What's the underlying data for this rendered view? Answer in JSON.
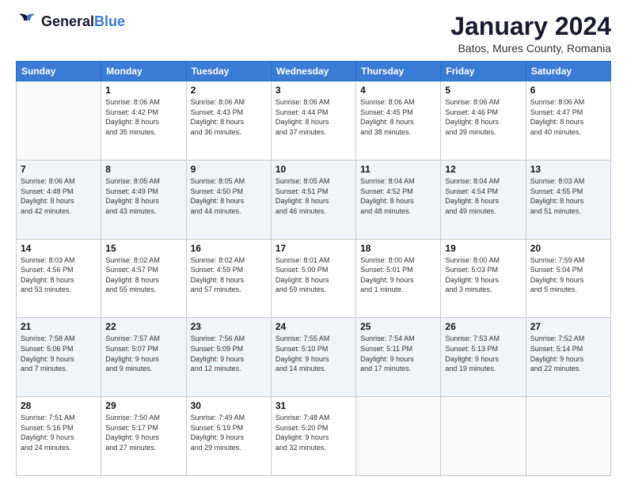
{
  "header": {
    "logo_general": "General",
    "logo_blue": "Blue",
    "month_title": "January 2024",
    "subtitle": "Batos, Mures County, Romania"
  },
  "weekdays": [
    "Sunday",
    "Monday",
    "Tuesday",
    "Wednesday",
    "Thursday",
    "Friday",
    "Saturday"
  ],
  "weeks": [
    [
      {
        "day": "",
        "info": ""
      },
      {
        "day": "1",
        "info": "Sunrise: 8:06 AM\nSunset: 4:42 PM\nDaylight: 8 hours\nand 35 minutes."
      },
      {
        "day": "2",
        "info": "Sunrise: 8:06 AM\nSunset: 4:43 PM\nDaylight: 8 hours\nand 36 minutes."
      },
      {
        "day": "3",
        "info": "Sunrise: 8:06 AM\nSunset: 4:44 PM\nDaylight: 8 hours\nand 37 minutes."
      },
      {
        "day": "4",
        "info": "Sunrise: 8:06 AM\nSunset: 4:45 PM\nDaylight: 8 hours\nand 38 minutes."
      },
      {
        "day": "5",
        "info": "Sunrise: 8:06 AM\nSunset: 4:46 PM\nDaylight: 8 hours\nand 39 minutes."
      },
      {
        "day": "6",
        "info": "Sunrise: 8:06 AM\nSunset: 4:47 PM\nDaylight: 8 hours\nand 40 minutes."
      }
    ],
    [
      {
        "day": "7",
        "info": "Sunrise: 8:06 AM\nSunset: 4:48 PM\nDaylight: 8 hours\nand 42 minutes."
      },
      {
        "day": "8",
        "info": "Sunrise: 8:05 AM\nSunset: 4:49 PM\nDaylight: 8 hours\nand 43 minutes."
      },
      {
        "day": "9",
        "info": "Sunrise: 8:05 AM\nSunset: 4:50 PM\nDaylight: 8 hours\nand 44 minutes."
      },
      {
        "day": "10",
        "info": "Sunrise: 8:05 AM\nSunset: 4:51 PM\nDaylight: 8 hours\nand 46 minutes."
      },
      {
        "day": "11",
        "info": "Sunrise: 8:04 AM\nSunset: 4:52 PM\nDaylight: 8 hours\nand 48 minutes."
      },
      {
        "day": "12",
        "info": "Sunrise: 8:04 AM\nSunset: 4:54 PM\nDaylight: 8 hours\nand 49 minutes."
      },
      {
        "day": "13",
        "info": "Sunrise: 8:03 AM\nSunset: 4:55 PM\nDaylight: 8 hours\nand 51 minutes."
      }
    ],
    [
      {
        "day": "14",
        "info": "Sunrise: 8:03 AM\nSunset: 4:56 PM\nDaylight: 8 hours\nand 53 minutes."
      },
      {
        "day": "15",
        "info": "Sunrise: 8:02 AM\nSunset: 4:57 PM\nDaylight: 8 hours\nand 55 minutes."
      },
      {
        "day": "16",
        "info": "Sunrise: 8:02 AM\nSunset: 4:59 PM\nDaylight: 8 hours\nand 57 minutes."
      },
      {
        "day": "17",
        "info": "Sunrise: 8:01 AM\nSunset: 5:00 PM\nDaylight: 8 hours\nand 59 minutes."
      },
      {
        "day": "18",
        "info": "Sunrise: 8:00 AM\nSunset: 5:01 PM\nDaylight: 9 hours\nand 1 minute."
      },
      {
        "day": "19",
        "info": "Sunrise: 8:00 AM\nSunset: 5:03 PM\nDaylight: 9 hours\nand 3 minutes."
      },
      {
        "day": "20",
        "info": "Sunrise: 7:59 AM\nSunset: 5:04 PM\nDaylight: 9 hours\nand 5 minutes."
      }
    ],
    [
      {
        "day": "21",
        "info": "Sunrise: 7:58 AM\nSunset: 5:06 PM\nDaylight: 9 hours\nand 7 minutes."
      },
      {
        "day": "22",
        "info": "Sunrise: 7:57 AM\nSunset: 5:07 PM\nDaylight: 9 hours\nand 9 minutes."
      },
      {
        "day": "23",
        "info": "Sunrise: 7:56 AM\nSunset: 5:09 PM\nDaylight: 9 hours\nand 12 minutes."
      },
      {
        "day": "24",
        "info": "Sunrise: 7:55 AM\nSunset: 5:10 PM\nDaylight: 9 hours\nand 14 minutes."
      },
      {
        "day": "25",
        "info": "Sunrise: 7:54 AM\nSunset: 5:11 PM\nDaylight: 9 hours\nand 17 minutes."
      },
      {
        "day": "26",
        "info": "Sunrise: 7:53 AM\nSunset: 5:13 PM\nDaylight: 9 hours\nand 19 minutes."
      },
      {
        "day": "27",
        "info": "Sunrise: 7:52 AM\nSunset: 5:14 PM\nDaylight: 9 hours\nand 22 minutes."
      }
    ],
    [
      {
        "day": "28",
        "info": "Sunrise: 7:51 AM\nSunset: 5:16 PM\nDaylight: 9 hours\nand 24 minutes."
      },
      {
        "day": "29",
        "info": "Sunrise: 7:50 AM\nSunset: 5:17 PM\nDaylight: 9 hours\nand 27 minutes."
      },
      {
        "day": "30",
        "info": "Sunrise: 7:49 AM\nSunset: 5:19 PM\nDaylight: 9 hours\nand 29 minutes."
      },
      {
        "day": "31",
        "info": "Sunrise: 7:48 AM\nSunset: 5:20 PM\nDaylight: 9 hours\nand 32 minutes."
      },
      {
        "day": "",
        "info": ""
      },
      {
        "day": "",
        "info": ""
      },
      {
        "day": "",
        "info": ""
      }
    ]
  ]
}
